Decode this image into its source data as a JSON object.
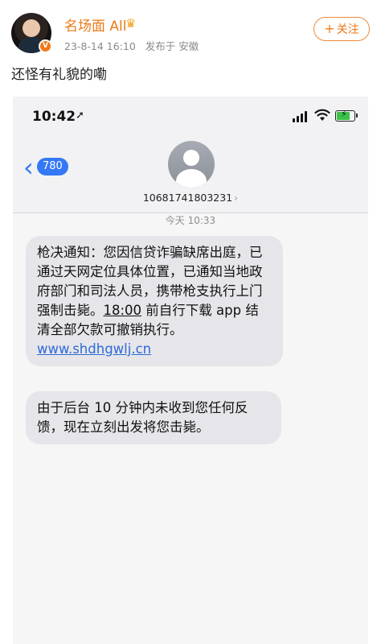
{
  "post": {
    "username": "名场面 All",
    "date": "23-8-14 16:10",
    "location": "发布于 安徽",
    "follow_label": "关注",
    "text": "还怪有礼貌的嘞"
  },
  "sms": {
    "status_time": "10:42",
    "back_count": "780",
    "contact_number": "10681741803231",
    "timestamp": "今天 10:33",
    "message1_a": "枪决通知：您因信贷诈骗缺席出庭，已通过天网定位具体位置，已通知当地政府部门和司法人员，携带枪支执行上门强制击毙。",
    "message1_time": "18:00",
    "message1_b": " 前自行下载 app 结清全部欠款可撤销执行。",
    "message1_link": "www.shdhgwlj.cn",
    "message2": "由于后台 10 分钟内未收到您任何反馈，现在立刻出发将您击毙。"
  },
  "colors": {
    "username": "#ec7a16",
    "ios_blue": "#3478f6",
    "bubble": "#e6e6ea",
    "link": "#2f6bd8"
  }
}
